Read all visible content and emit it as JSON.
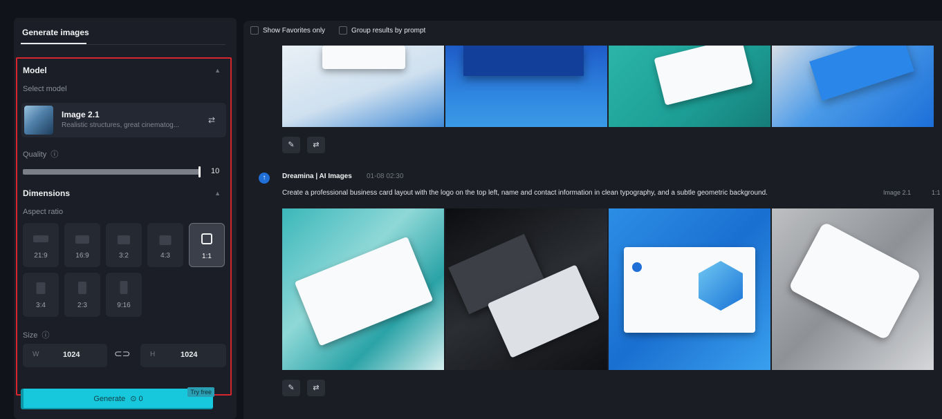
{
  "left_panel": {
    "tab_label": "Generate images",
    "model_section": {
      "title": "Model",
      "select_label": "Select model",
      "model_name": "Image 2.1",
      "model_desc": "Realistic structures, great cinematog..."
    },
    "quality": {
      "label": "Quality",
      "value": "10",
      "fraction": 1.0
    },
    "dimensions": {
      "title": "Dimensions",
      "aspect_label": "Aspect ratio",
      "ratios": [
        "21:9",
        "16:9",
        "3:2",
        "4:3",
        "1:1",
        "3:4",
        "2:3",
        "9:16"
      ],
      "selected": "1:1"
    },
    "size": {
      "label": "Size",
      "w_prefix": "W",
      "w_value": "1024",
      "h_prefix": "H",
      "h_value": "1024"
    },
    "generate": {
      "label": "Generate",
      "cost": "0",
      "badge": "Try free"
    }
  },
  "right_panel": {
    "toolbar": {
      "favorites": "Show Favorites only",
      "group": "Group results by prompt"
    },
    "result": {
      "source": "Dreamina | AI Images",
      "time": "01-08  02:30",
      "prompt": "Create a professional business card layout with the logo on the top left, name and contact information in clean typography, and a subtle geometric background.",
      "model": "Image 2.1",
      "ratio": "1:1"
    }
  },
  "colors": {
    "accent": "#17c7dc",
    "highlight_border": "#d8262e",
    "panel": "#1b1e26",
    "background": "#101319"
  },
  "icons": [
    "info-icon",
    "chevron-up-icon",
    "sliders-icon",
    "link-icon",
    "coin-icon",
    "edit-icon",
    "retry-icon",
    "ai-logo-icon"
  ]
}
